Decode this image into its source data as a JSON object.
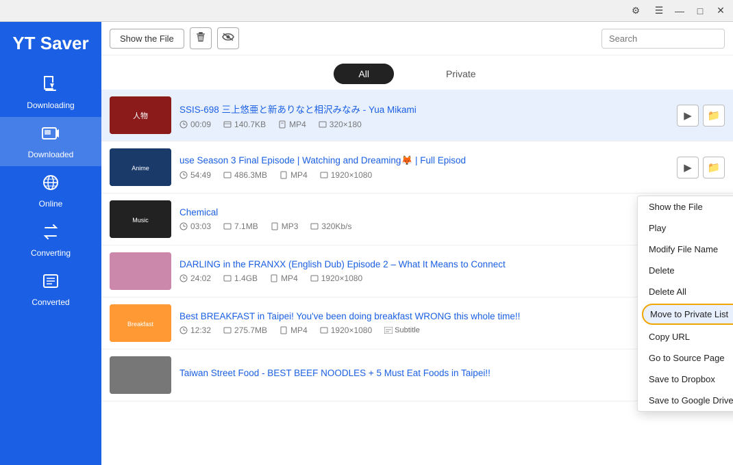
{
  "app": {
    "title": "YT Saver"
  },
  "titlebar": {
    "settings_icon": "⚙",
    "hamburger_icon": "☰",
    "minimize_icon": "—",
    "maximize_icon": "□",
    "close_icon": "✕"
  },
  "sidebar": {
    "logo": "YT Saver",
    "items": [
      {
        "id": "downloading",
        "label": "Downloading",
        "icon": "⬇"
      },
      {
        "id": "downloaded",
        "label": "Downloaded",
        "icon": "🎬"
      },
      {
        "id": "online",
        "label": "Online",
        "icon": "🌐"
      },
      {
        "id": "converting",
        "label": "Converting",
        "icon": "↗"
      },
      {
        "id": "converted",
        "label": "Converted",
        "icon": "📋"
      }
    ]
  },
  "toolbar": {
    "show_file_btn": "Show the File",
    "delete_icon": "🗑",
    "eye_icon": "👁",
    "search_placeholder": "Search"
  },
  "tabs": {
    "all_label": "All",
    "private_label": "Private"
  },
  "files": [
    {
      "title": "SSIS-698 三上悠亜と新ありなと相沢みなみ - Yua Mikami",
      "duration": "00:09",
      "size": "140.7KB",
      "format": "MP4",
      "resolution": "320×180",
      "thumb_class": "thumb-1"
    },
    {
      "title": "use Season 3 Final Episode | Watching and Dreaming🦊 | Full Episod",
      "duration": "54:49",
      "size": "486.3MB",
      "format": "MP4",
      "resolution": "1920×1080",
      "thumb_class": "thumb-2"
    },
    {
      "title": "Chemical",
      "duration": "03:03",
      "size": "7.1MB",
      "format": "MP3",
      "resolution": "320Kb/s",
      "thumb_class": "thumb-3"
    },
    {
      "title": "DARLING in the FRANXX (English Dub) Episode 2 – What It Means to Connect",
      "duration": "24:02",
      "size": "1.4GB",
      "format": "MP4",
      "resolution": "1920×1080",
      "thumb_class": "thumb-4"
    },
    {
      "title": "Best BREAKFAST in Taipei! You've been doing breakfast WRONG this whole time!!",
      "duration": "12:32",
      "size": "275.7MB",
      "format": "MP4",
      "resolution": "1920×1080",
      "has_subtitle": true,
      "subtitle_label": "Subtitle",
      "thumb_class": "thumb-5"
    },
    {
      "title": "Taiwan Street Food - BEST BEEF NOODLES + 5 Must Eat Foods in Taipei!!",
      "duration": "",
      "size": "",
      "format": "",
      "resolution": "",
      "thumb_class": "thumb-6"
    }
  ],
  "context_menu": {
    "items": [
      {
        "id": "show-file",
        "label": "Show the File"
      },
      {
        "id": "play",
        "label": "Play"
      },
      {
        "id": "modify-name",
        "label": "Modify File Name"
      },
      {
        "id": "delete",
        "label": "Delete"
      },
      {
        "id": "delete-all",
        "label": "Delete All"
      },
      {
        "id": "move-to-private",
        "label": "Move to Private List",
        "highlighted": true
      },
      {
        "id": "copy-url",
        "label": "Copy URL"
      },
      {
        "id": "go-to-source",
        "label": "Go to Source Page"
      },
      {
        "id": "save-dropbox",
        "label": "Save to Dropbox"
      },
      {
        "id": "save-gdrive",
        "label": "Save to Google Drive"
      }
    ]
  }
}
